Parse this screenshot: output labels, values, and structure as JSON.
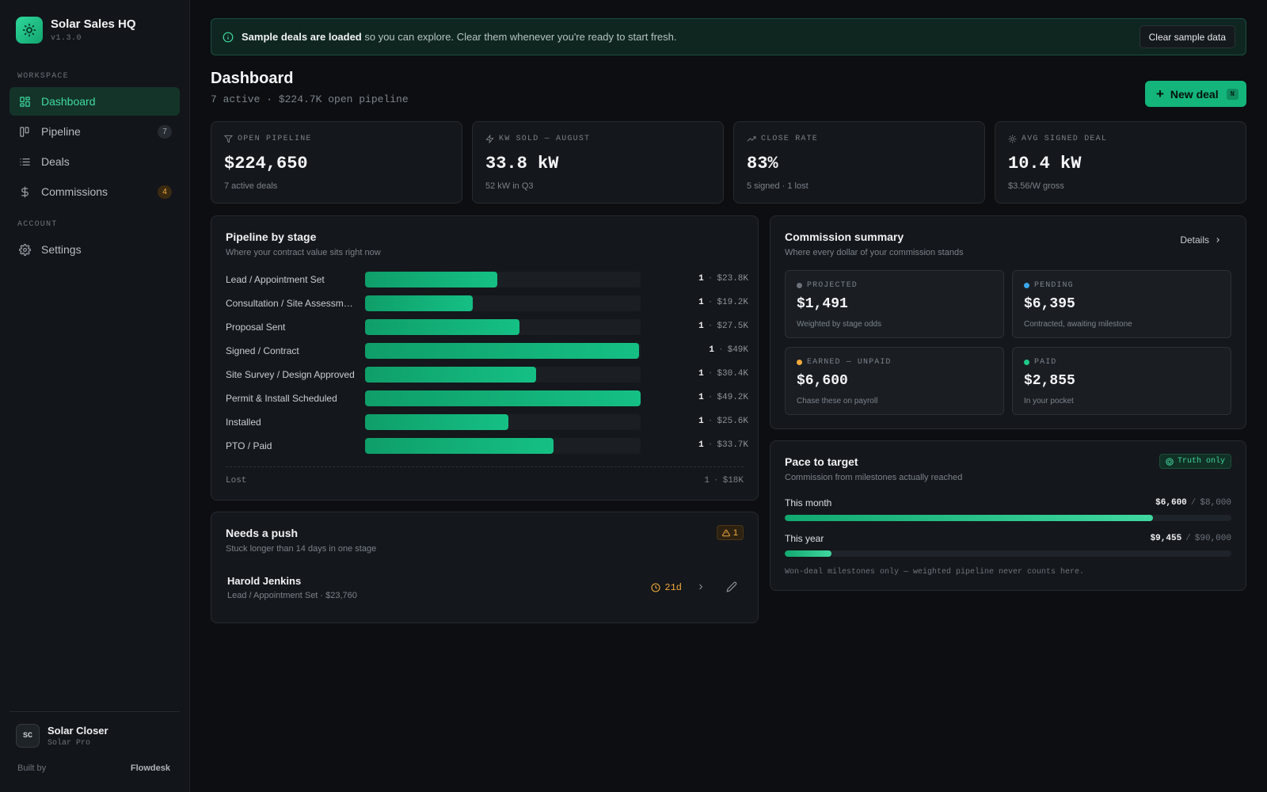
{
  "brand": {
    "name": "Solar Sales HQ",
    "version": "v1.3.0"
  },
  "nav": {
    "workspace_label": "WORKSPACE",
    "account_label": "ACCOUNT",
    "items": [
      {
        "label": "Dashboard",
        "icon": "dashboard-icon",
        "active": true
      },
      {
        "label": "Pipeline",
        "icon": "kanban-icon",
        "badge": "7"
      },
      {
        "label": "Deals",
        "icon": "list-icon"
      },
      {
        "label": "Commissions",
        "icon": "dollar-icon",
        "badge": "4"
      },
      {
        "label": "Settings",
        "icon": "gear-icon"
      }
    ]
  },
  "user": {
    "initials": "SC",
    "name": "Solar Closer",
    "role": "Solar Pro"
  },
  "footer": {
    "built_by": "Built by",
    "company": "Flowdesk"
  },
  "banner": {
    "bold": "Sample deals are loaded",
    "text": " so you can explore. Clear them whenever you're ready to start fresh.",
    "button": "Clear sample data"
  },
  "header": {
    "title": "Dashboard",
    "subtitle": "7 active · $224.7K open pipeline",
    "new_deal": "New deal",
    "shortcut": "N"
  },
  "stats": [
    {
      "label": "OPEN PIPELINE",
      "value": "$224,650",
      "sub": "7 active deals",
      "icon": "filter-icon"
    },
    {
      "label": "KW SOLD — AUGUST",
      "value": "33.8 kW",
      "sub": "52 kW in Q3",
      "icon": "bolt-icon"
    },
    {
      "label": "CLOSE RATE",
      "value": "83%",
      "sub": "5 signed · 1 lost",
      "icon": "trending-up-icon"
    },
    {
      "label": "AVG SIGNED DEAL",
      "value": "10.4 kW",
      "sub": "$3.56/W gross",
      "icon": "sun-icon"
    }
  ],
  "pipeline": {
    "title": "Pipeline by stage",
    "subtitle": "Where your contract value sits right now",
    "sep": "·",
    "stages": [
      {
        "name": "Lead / Appointment Set",
        "count": "1",
        "amount": "$23.8K",
        "fill": 0.48
      },
      {
        "name": "Consultation / Site Assessm…",
        "count": "1",
        "amount": "$19.2K",
        "fill": 0.39
      },
      {
        "name": "Proposal Sent",
        "count": "1",
        "amount": "$27.5K",
        "fill": 0.56
      },
      {
        "name": "Signed / Contract",
        "count": "1",
        "amount": "$49K",
        "fill": 0.995
      },
      {
        "name": "Site Survey / Design Approved",
        "count": "1",
        "amount": "$30.4K",
        "fill": 0.62
      },
      {
        "name": "Permit & Install Scheduled",
        "count": "1",
        "amount": "$49.2K",
        "fill": 1.0
      },
      {
        "name": "Installed",
        "count": "1",
        "amount": "$25.6K",
        "fill": 0.52
      },
      {
        "name": "PTO / Paid",
        "count": "1",
        "amount": "$33.7K",
        "fill": 0.685
      }
    ],
    "lost": {
      "label": "Lost",
      "count": "1",
      "amount": "$18K"
    }
  },
  "commission": {
    "title": "Commission summary",
    "subtitle": "Where every dollar of your commission stands",
    "details": "Details",
    "tiles": [
      {
        "label": "PROJECTED",
        "value": "$1,491",
        "sub": "Weighted by stage odds",
        "color": "#6b727a"
      },
      {
        "label": "PENDING",
        "value": "$6,395",
        "sub": "Contracted, awaiting milestone",
        "color": "#3aa8ea"
      },
      {
        "label": "EARNED — UNPAID",
        "value": "$6,600",
        "sub": "Chase these on payroll",
        "color": "#f0a93b"
      },
      {
        "label": "PAID",
        "value": "$2,855",
        "sub": "In your pocket",
        "color": "#1fc98a"
      }
    ]
  },
  "pace": {
    "title": "Pace to target",
    "subtitle": "Commission from milestones actually reached",
    "pill": "Truth only",
    "month": {
      "label": "This month",
      "value": "$6,600",
      "target": "$8,000",
      "progress": 0.825
    },
    "year": {
      "label": "This year",
      "value": "$9,455",
      "target": "$90,000",
      "progress": 0.105
    },
    "slash": "/",
    "note": "Won-deal milestones only — weighted pipeline never counts here."
  },
  "push": {
    "title": "Needs a push",
    "subtitle": "Stuck longer than 14 days in one stage",
    "count": "1",
    "deal": {
      "name": "Harold Jenkins",
      "sub": "Lead / Appointment Set · $23,760",
      "age": "21d"
    }
  },
  "colors": {
    "accent": "#13b57a",
    "warning": "#f0a93b",
    "info": "#3aa8ea"
  }
}
